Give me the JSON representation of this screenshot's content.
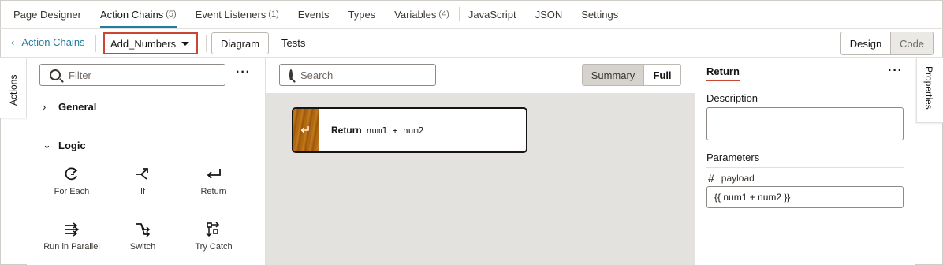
{
  "tabs": [
    {
      "label": "Page Designer",
      "count": ""
    },
    {
      "label": "Action Chains",
      "count": "(5)"
    },
    {
      "label": "Event Listeners",
      "count": "(1)"
    },
    {
      "label": "Events",
      "count": ""
    },
    {
      "label": "Types",
      "count": ""
    },
    {
      "label": "Variables",
      "count": "(4)"
    },
    {
      "label": "JavaScript",
      "count": ""
    },
    {
      "label": "JSON",
      "count": ""
    },
    {
      "label": "Settings",
      "count": ""
    }
  ],
  "toolbar": {
    "back_label": "Action Chains",
    "chain_name": "Add_Numbers",
    "diagram_label": "Diagram",
    "tests_label": "Tests",
    "design_label": "Design",
    "code_label": "Code"
  },
  "left_tab": "Actions",
  "left_panel": {
    "filter_placeholder": "Filter",
    "sections": [
      {
        "label": "General"
      },
      {
        "label": "Logic"
      }
    ],
    "actions": [
      {
        "label": "For Each",
        "icon": "for-each-icon"
      },
      {
        "label": "If",
        "icon": "if-icon"
      },
      {
        "label": "Return",
        "icon": "return-icon"
      },
      {
        "label": "Run in Parallel",
        "icon": "run-in-parallel-icon"
      },
      {
        "label": "Switch",
        "icon": "switch-icon"
      },
      {
        "label": "Try Catch",
        "icon": "try-catch-icon"
      }
    ]
  },
  "canvas": {
    "search_placeholder": "Search",
    "summary_label": "Summary",
    "full_label": "Full",
    "node": {
      "keyword": "Return",
      "expression": "num1 + num2",
      "icon": "return-icon"
    }
  },
  "properties": {
    "title": "Return",
    "description_label": "Description",
    "parameters_label": "Parameters",
    "param_name": "payload",
    "param_value": "{{ num1 + num2 }}"
  },
  "right_tab": "Properties",
  "colors": {
    "accent": "#227e9e",
    "highlight": "#c74634"
  }
}
